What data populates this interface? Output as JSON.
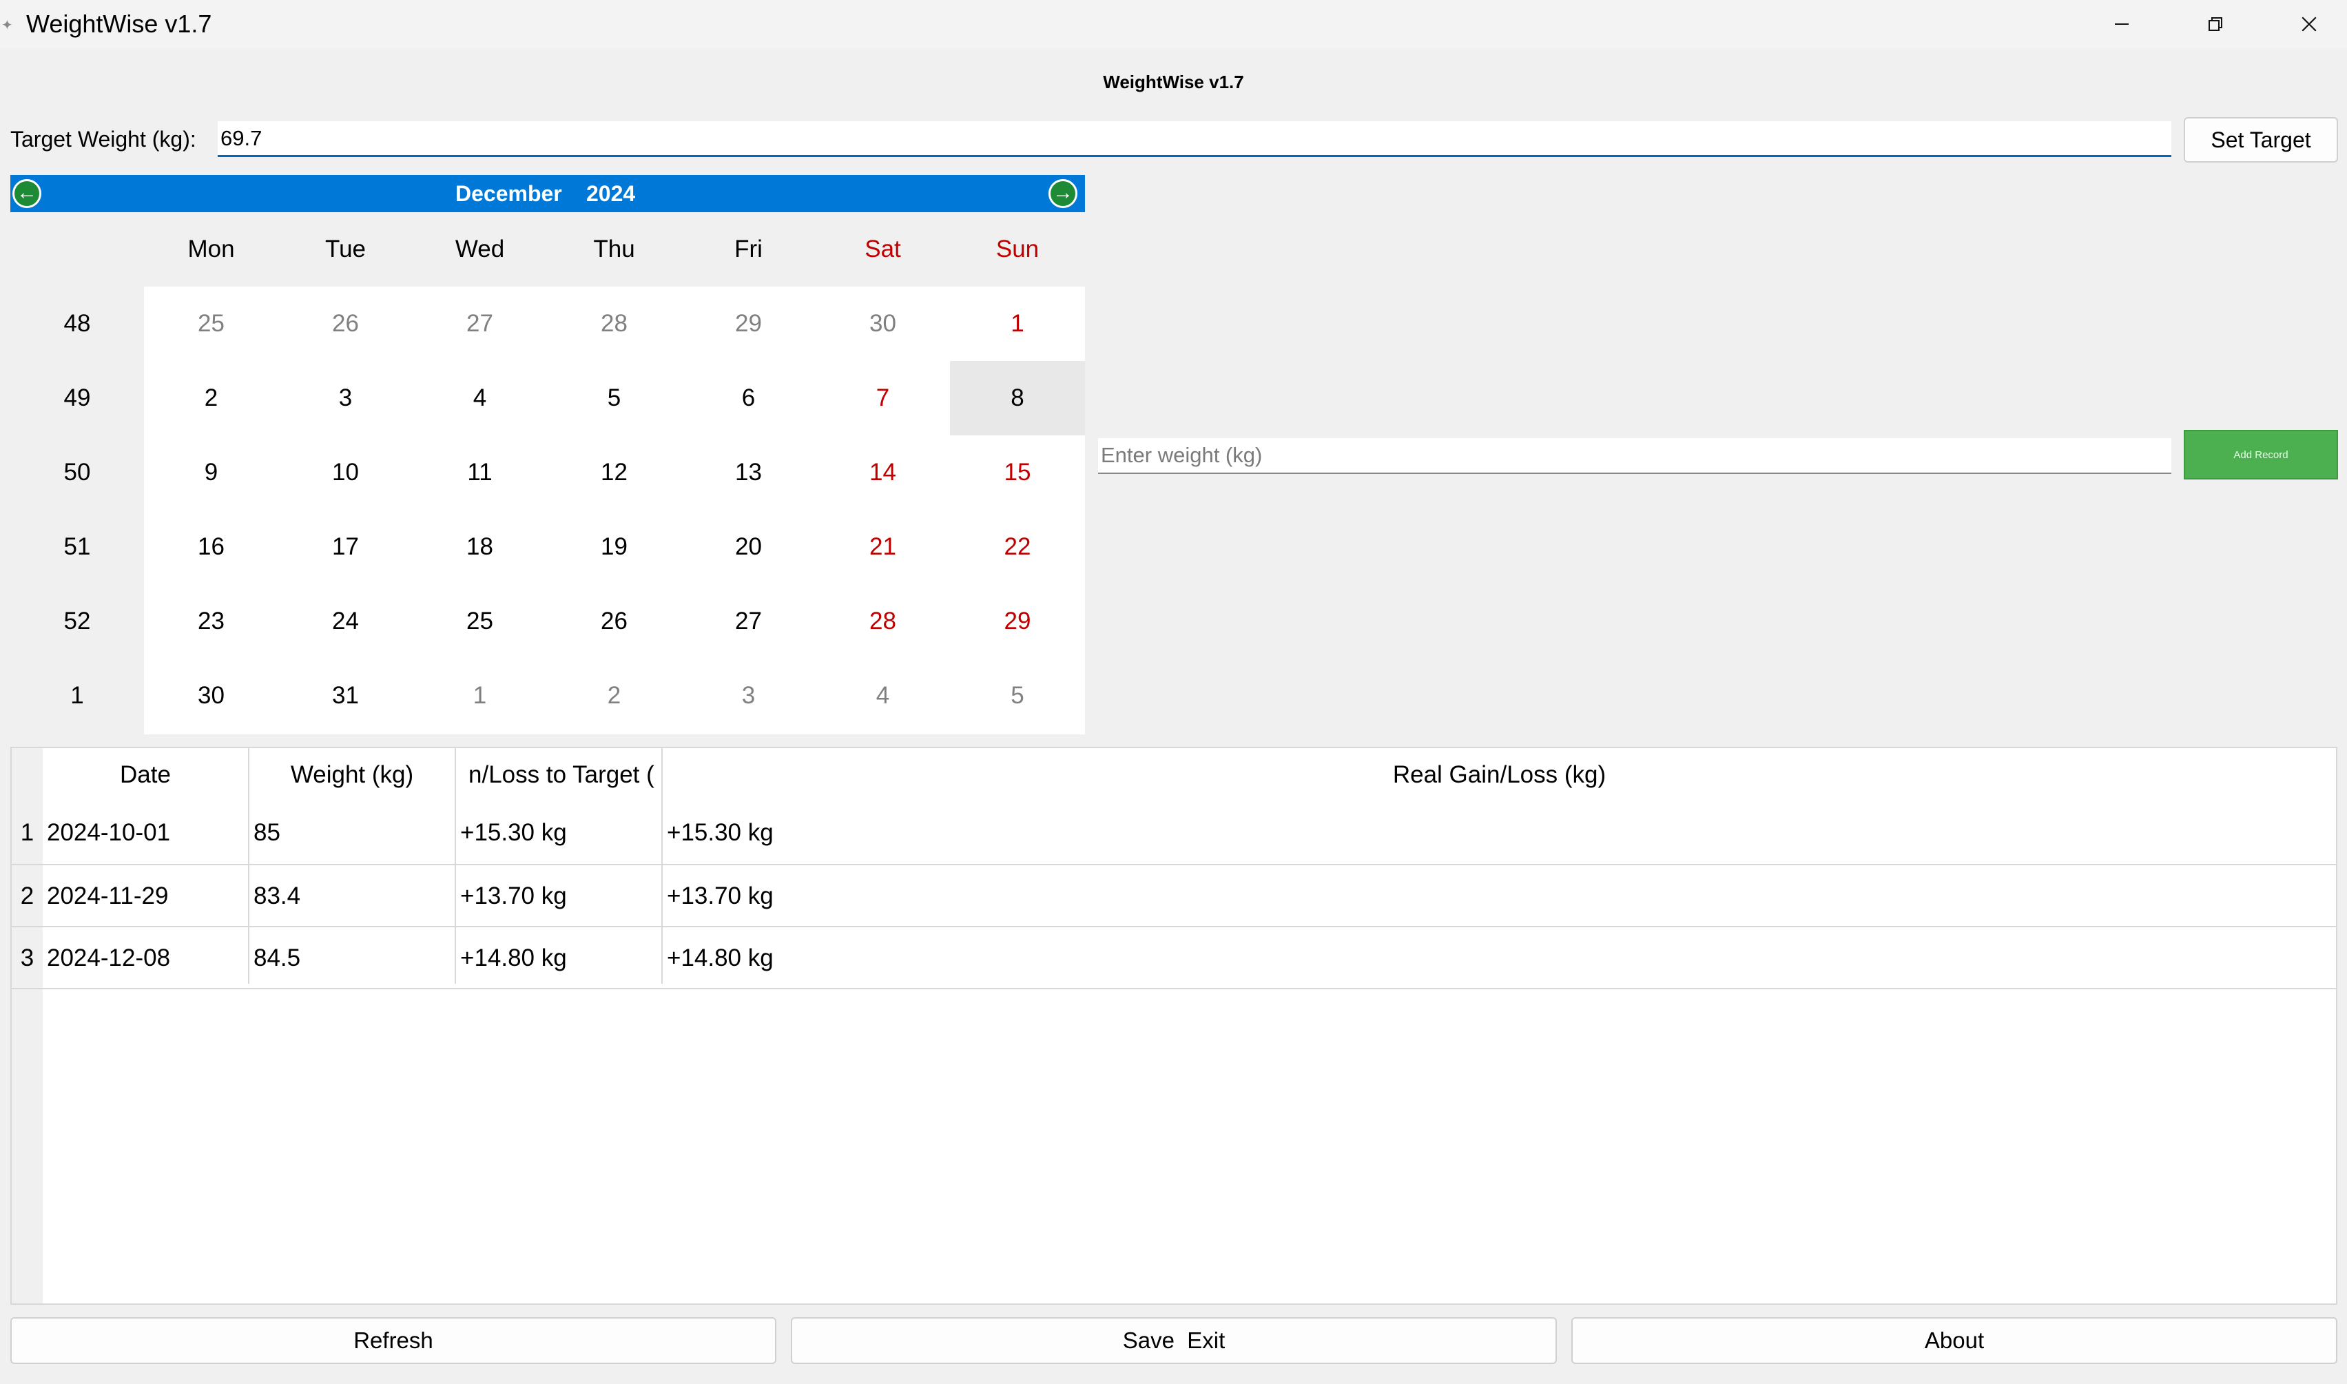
{
  "window": {
    "title": "WeightWise v1.7",
    "minimize_icon": "minimize-icon",
    "maximize_icon": "restore-icon",
    "close_icon": "close-icon"
  },
  "app_heading": "WeightWise v1.7",
  "target": {
    "label": "Target Weight (kg):",
    "value": "69.7",
    "button": "Set Target"
  },
  "calendar": {
    "month": "December",
    "year": "2024",
    "prev_icon": "arrow-left-icon",
    "next_icon": "arrow-right-icon",
    "weekdays": [
      "Mon",
      "Tue",
      "Wed",
      "Thu",
      "Fri",
      "Sat",
      "Sun"
    ],
    "weeks": [
      {
        "week": "48",
        "days": [
          "25",
          "26",
          "27",
          "28",
          "29",
          "30",
          "1"
        ]
      },
      {
        "week": "49",
        "days": [
          "2",
          "3",
          "4",
          "5",
          "6",
          "7",
          "8"
        ]
      },
      {
        "week": "50",
        "days": [
          "9",
          "10",
          "11",
          "12",
          "13",
          "14",
          "15"
        ]
      },
      {
        "week": "51",
        "days": [
          "16",
          "17",
          "18",
          "19",
          "20",
          "21",
          "22"
        ]
      },
      {
        "week": "52",
        "days": [
          "23",
          "24",
          "25",
          "26",
          "27",
          "28",
          "29"
        ]
      },
      {
        "week": "1",
        "days": [
          "30",
          "31",
          "1",
          "2",
          "3",
          "4",
          "5"
        ]
      }
    ],
    "selected_day": "8"
  },
  "weight_entry": {
    "placeholder": "Enter weight (kg)",
    "button": "Add Record",
    "button_color": "#4caf50"
  },
  "table": {
    "headers": [
      "Date",
      "Weight (kg)",
      "n/Loss to Target (",
      "Real Gain/Loss (kg)"
    ],
    "rows": [
      {
        "num": "1",
        "date": "2024-10-01",
        "weight": "85",
        "to_target": "+15.30 kg",
        "real": "+15.30 kg"
      },
      {
        "num": "2",
        "date": "2024-11-29",
        "weight": "83.4",
        "to_target": "+13.70 kg",
        "real": "+13.70 kg"
      },
      {
        "num": "3",
        "date": "2024-12-08",
        "weight": "84.5",
        "to_target": "+14.80 kg",
        "real": "+14.80 kg"
      }
    ]
  },
  "buttons": {
    "refresh": "Refresh",
    "save_exit": "Save  Exit",
    "about": "About"
  },
  "colors": {
    "calendar_header": "#0078d7",
    "weekend_text": "#c00000",
    "input_focus": "#0067c0"
  }
}
